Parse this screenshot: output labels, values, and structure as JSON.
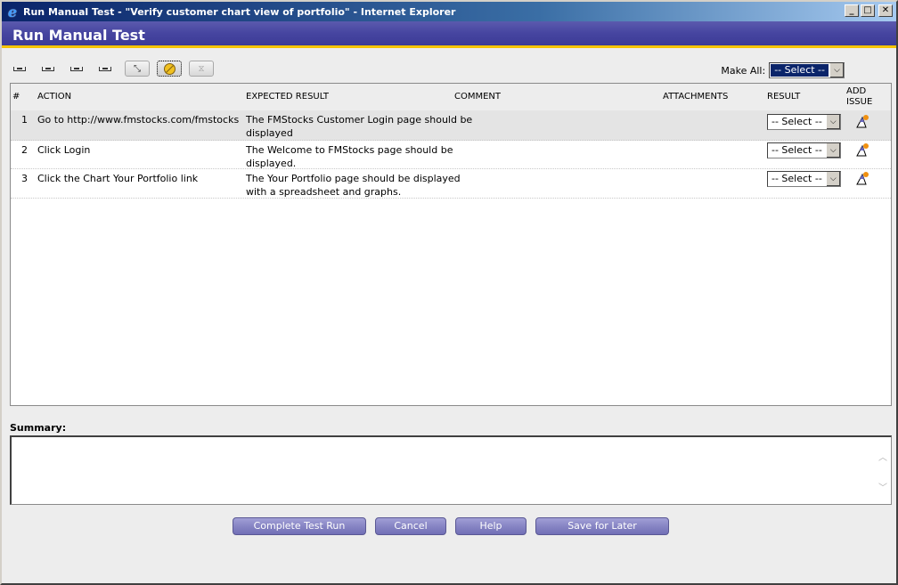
{
  "window": {
    "title": "Run Manual Test - \"Verify customer chart view of portfolio\" - Internet Explorer",
    "controls": {
      "minimize": "_",
      "maximize": "□",
      "close": "✕"
    }
  },
  "header": {
    "title": "Run Manual Test"
  },
  "toolbar": {
    "icons": [
      "step-icon",
      "step-icon",
      "step-icon",
      "step-icon",
      "collapse-icon",
      "pass-fail-icon",
      "timer-icon"
    ],
    "collapse_glyph": "⤡",
    "timer_glyph": "⧖"
  },
  "make_all": {
    "label": "Make All:",
    "value": "-- Select --"
  },
  "grid": {
    "columns": {
      "num": "#",
      "action": "ACTION",
      "expected": "EXPECTED RESULT",
      "comment": "COMMENT",
      "attachments": "ATTACHMENTS",
      "result": "RESULT",
      "add_issue_1": "ADD",
      "add_issue_2": "ISSUE"
    },
    "rows": [
      {
        "num": "1",
        "action": "Go to http://www.fmstocks.com/fmstocks",
        "expected_1": "The FMStocks Customer Login page should be",
        "expected_2": "displayed",
        "result": "-- Select --"
      },
      {
        "num": "2",
        "action": "Click Login",
        "expected_1": "The Welcome to FMStocks page should be",
        "expected_2": "displayed.",
        "result": "-- Select --"
      },
      {
        "num": "3",
        "action": "Click the Chart Your Portfolio link",
        "expected_1": "The Your Portfolio page should be displayed",
        "expected_2": "with a spreadsheet and graphs.",
        "result": "-- Select --"
      }
    ]
  },
  "summary": {
    "label": "Summary:",
    "value": ""
  },
  "buttons": {
    "complete": "Complete Test Run",
    "cancel": "Cancel",
    "help": "Help",
    "save": "Save for Later"
  },
  "colors": {
    "header_band": "#4645a0",
    "accent_stripe": "#f5c400",
    "button": "#8785c4"
  }
}
